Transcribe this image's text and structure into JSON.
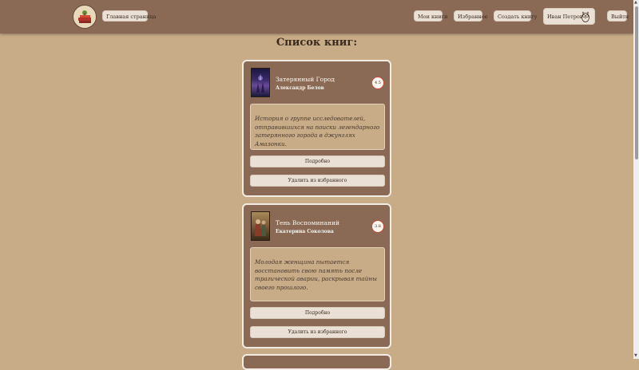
{
  "header": {
    "home_label": "Главная страница",
    "nav": [
      {
        "label": "Мои книги"
      },
      {
        "label": "Избранное"
      },
      {
        "label": "Создать книгу"
      }
    ],
    "user_name": "Иван Петров",
    "logout_label": "Выйти"
  },
  "main": {
    "title": "Список книг:"
  },
  "books": [
    {
      "title": "Затерянный Город",
      "author": "Александр Белов",
      "rating": "4.5",
      "description": "История о группе исследователей, отправившихся на поиски легендарного затерянного города в джунглях Амазонки.",
      "details_label": "Подробно",
      "remove_label": "Удалить из избранного"
    },
    {
      "title": "Тень Воспоминаний",
      "author": "Екатерина Соколова",
      "rating": "3.8",
      "description": "Молодая женщина пытается восстановить свою память после трагической аварии, раскрывая тайны своего прошлого.",
      "details_label": "Подробно",
      "remove_label": "Удалить из избранного"
    }
  ],
  "colors": {
    "page_bg": "#c8ab87",
    "header_bg": "#8a6a55",
    "card_bg": "#8a6a55",
    "button_bg": "#eae0d5",
    "rating_ring": "#c94a3a"
  },
  "icons": {
    "logo": "book-stack-logo-icon",
    "user": "owl-icon"
  }
}
